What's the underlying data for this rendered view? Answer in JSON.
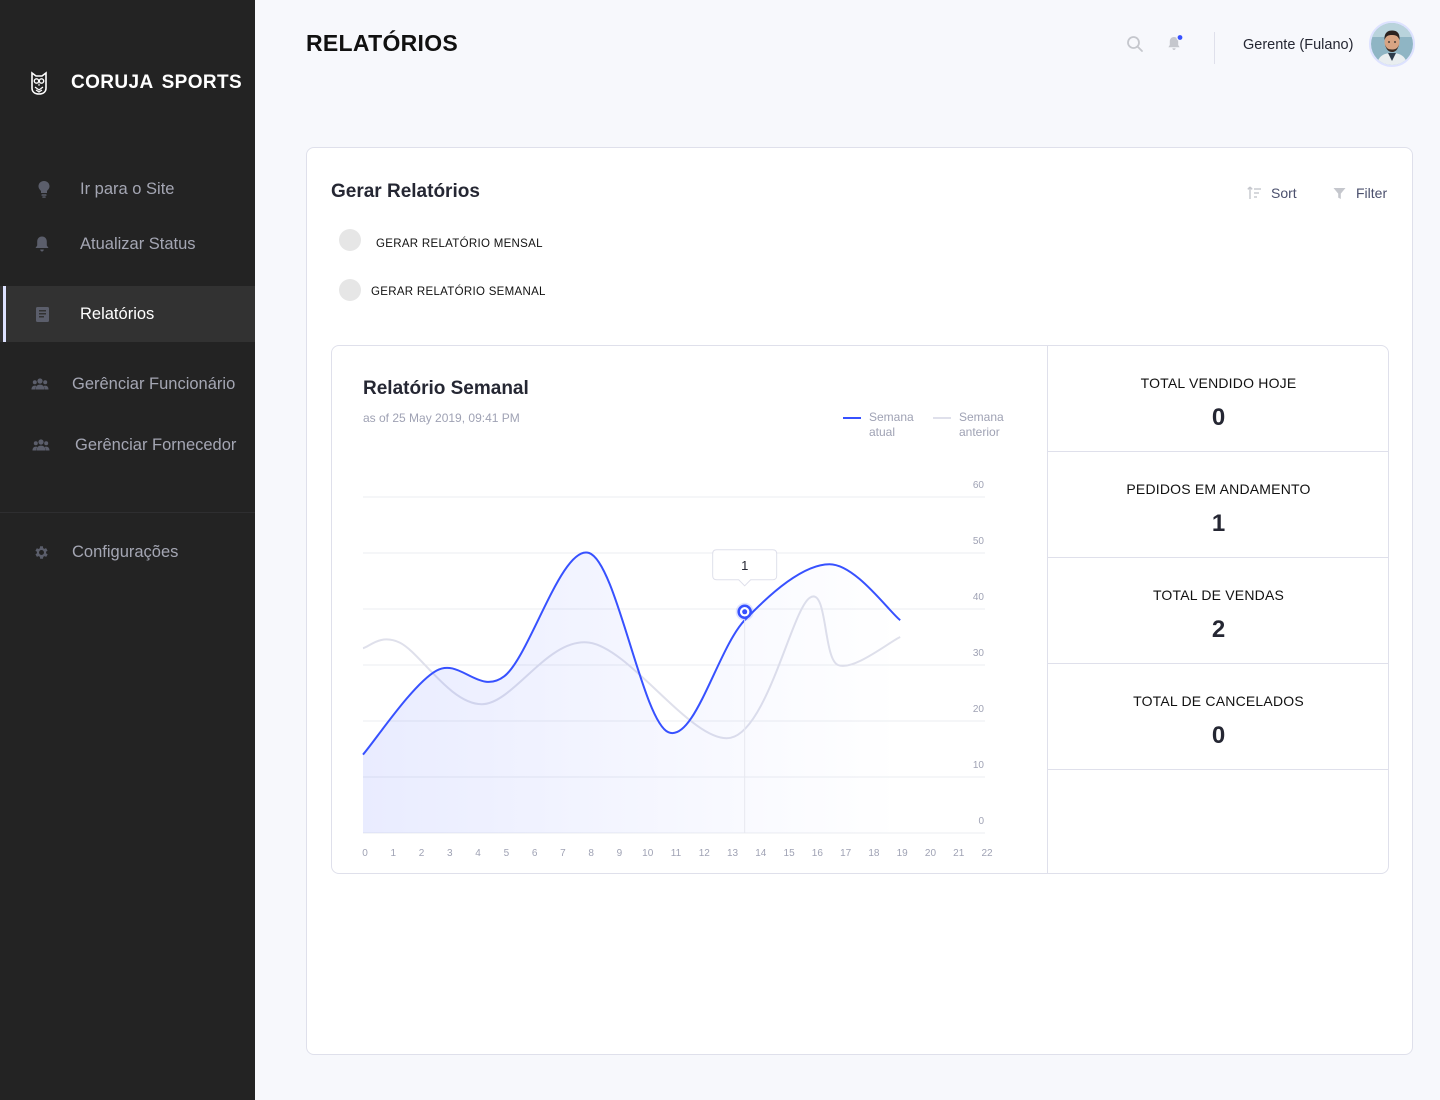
{
  "brand": {
    "name": "CORUJA  SPORTS",
    "logo_icon": "owl-logo-icon"
  },
  "sidebar": {
    "items": [
      {
        "label": "Ir para o Site",
        "icon": "lightbulb-icon"
      },
      {
        "label": "Atualizar Status",
        "icon": "bell-icon"
      },
      {
        "label": "Relatórios",
        "icon": "book-icon",
        "active": true
      },
      {
        "label": "Gerênciar Funcionário",
        "icon": "people-icon"
      },
      {
        "label": "Gerênciar Fornecedor",
        "icon": "people-icon"
      },
      {
        "label": "Configurações",
        "icon": "gear-icon"
      }
    ]
  },
  "header": {
    "title": "RELATÓRIOS",
    "search_icon": "search-icon",
    "notification_icon": "bell-icon",
    "notification_dot_color": "#3751ff",
    "user_name": "Gerente (Fulano)"
  },
  "card": {
    "title": "Gerar Relatórios",
    "sort_label": "Sort",
    "filter_label": "Filter",
    "options": [
      {
        "label": "GERAR RELATÓRIO MENSAL",
        "checked": false
      },
      {
        "label": "GERAR RELATÓRIO SEMANAL",
        "checked": false
      }
    ]
  },
  "chart_panel": {
    "title": "Relatório Semanal",
    "subtitle": "as of 25 May 2019, 09:41 PM",
    "tooltip_value": "1"
  },
  "chart_data": {
    "type": "line",
    "x": [
      0,
      1,
      2,
      3,
      4,
      5,
      6,
      7,
      8,
      9,
      10,
      11,
      12,
      13,
      14,
      15,
      16,
      17,
      18,
      19,
      20,
      21,
      22
    ],
    "x_ticks": [
      "0",
      "1",
      "2",
      "3",
      "4",
      "5",
      "6",
      "7",
      "8",
      "9",
      "10",
      "11",
      "12",
      "13",
      "14",
      "15",
      "16",
      "17",
      "18",
      "19",
      "20",
      "21",
      "22"
    ],
    "y_ticks": [
      "60",
      "50",
      "40",
      "30",
      "20",
      "10",
      "0"
    ],
    "ylim": [
      0,
      60
    ],
    "y_axis_side": "right",
    "grid": true,
    "legend_position": "top-right",
    "series": [
      {
        "name": "Semana atual",
        "color": "#3751ff",
        "filled": true,
        "x": [
          0,
          2.6,
          5,
          8,
          10.8,
          13.5,
          16.5,
          19
        ],
        "values": [
          14,
          29,
          28,
          50,
          18,
          38,
          48,
          38
        ]
      },
      {
        "name": "Semana anterior",
        "color": "#dfe0eb",
        "filled": false,
        "x": [
          0,
          1.3,
          4.2,
          8,
          13,
          15.8,
          16.8,
          19
        ],
        "values": [
          33,
          34,
          23,
          34,
          17,
          42,
          30,
          35
        ]
      }
    ],
    "highlight": {
      "x": 13.5,
      "y": 39.5,
      "label": "1"
    }
  },
  "stats": [
    {
      "label": "TOTAL VENDIDO HOJE",
      "value": "0"
    },
    {
      "label": "PEDIDOS EM ANDAMENTO",
      "value": "1"
    },
    {
      "label": "TOTAL DE VENDAS",
      "value": "2"
    },
    {
      "label": "TOTAL DE CANCELADOS",
      "value": "0"
    }
  ]
}
